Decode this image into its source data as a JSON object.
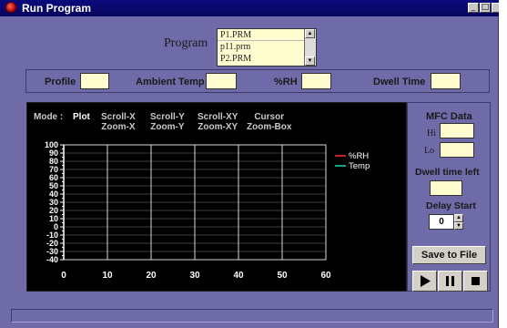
{
  "window": {
    "title": "Run Program"
  },
  "program": {
    "label": "Program",
    "files": [
      "P1.PRM",
      "p11.prm",
      "P2.PRM"
    ],
    "selected": "P1.PRM"
  },
  "params": {
    "profile_label": "Profile",
    "ambient_label": "Ambient Temp",
    "rh_label": "%RH",
    "dwell_label": "Dwell Time",
    "profile_value": "",
    "ambient_value": "",
    "rh_value": "",
    "dwell_value": ""
  },
  "modes": {
    "label": "Mode :",
    "plot": "Plot",
    "scrollx_1": "Scroll-X",
    "scrollx_2": "Zoom-X",
    "scrolly_1": "Scroll-Y",
    "scrolly_2": "Zoom-Y",
    "scrollxy_1": "Scroll-XY",
    "scrollxy_2": "Zoom-XY",
    "cursor_1": "Cursor",
    "cursor_2": "Zoom-Box"
  },
  "chart_data": {
    "type": "line",
    "xlim": [
      0,
      60
    ],
    "ylim": [
      -40,
      100
    ],
    "x_ticks": [
      "0",
      "10",
      "20",
      "30",
      "40",
      "50",
      "60"
    ],
    "y_ticks": [
      "100",
      "90",
      "80",
      "70",
      "60",
      "50",
      "40",
      "30",
      "20",
      "10",
      "0",
      "-10",
      "-20",
      "-30",
      "-40"
    ],
    "grid": true,
    "legend_position": "top-right",
    "series": [
      {
        "name": "%RH",
        "color": "#ff3030",
        "values": []
      },
      {
        "name": "Temp",
        "color": "#19d8b8",
        "values": []
      }
    ]
  },
  "mfc": {
    "title": "MFC Data",
    "hi_label": "Hi",
    "lo_label": "Lo",
    "hi_value": "",
    "lo_value": "",
    "dwell_left_label": "Dwell time left",
    "dwell_left_value": "",
    "delay_label": "Delay Start",
    "delay_value": "0"
  },
  "controls": {
    "save_label": "Save to File"
  },
  "colors": {
    "window_bg": "#6f6aa8",
    "titlebar": "#0b0a7c",
    "field_bg": "#fffdd0",
    "chart_bg": "#000000",
    "grid": "#d8d8d8"
  }
}
